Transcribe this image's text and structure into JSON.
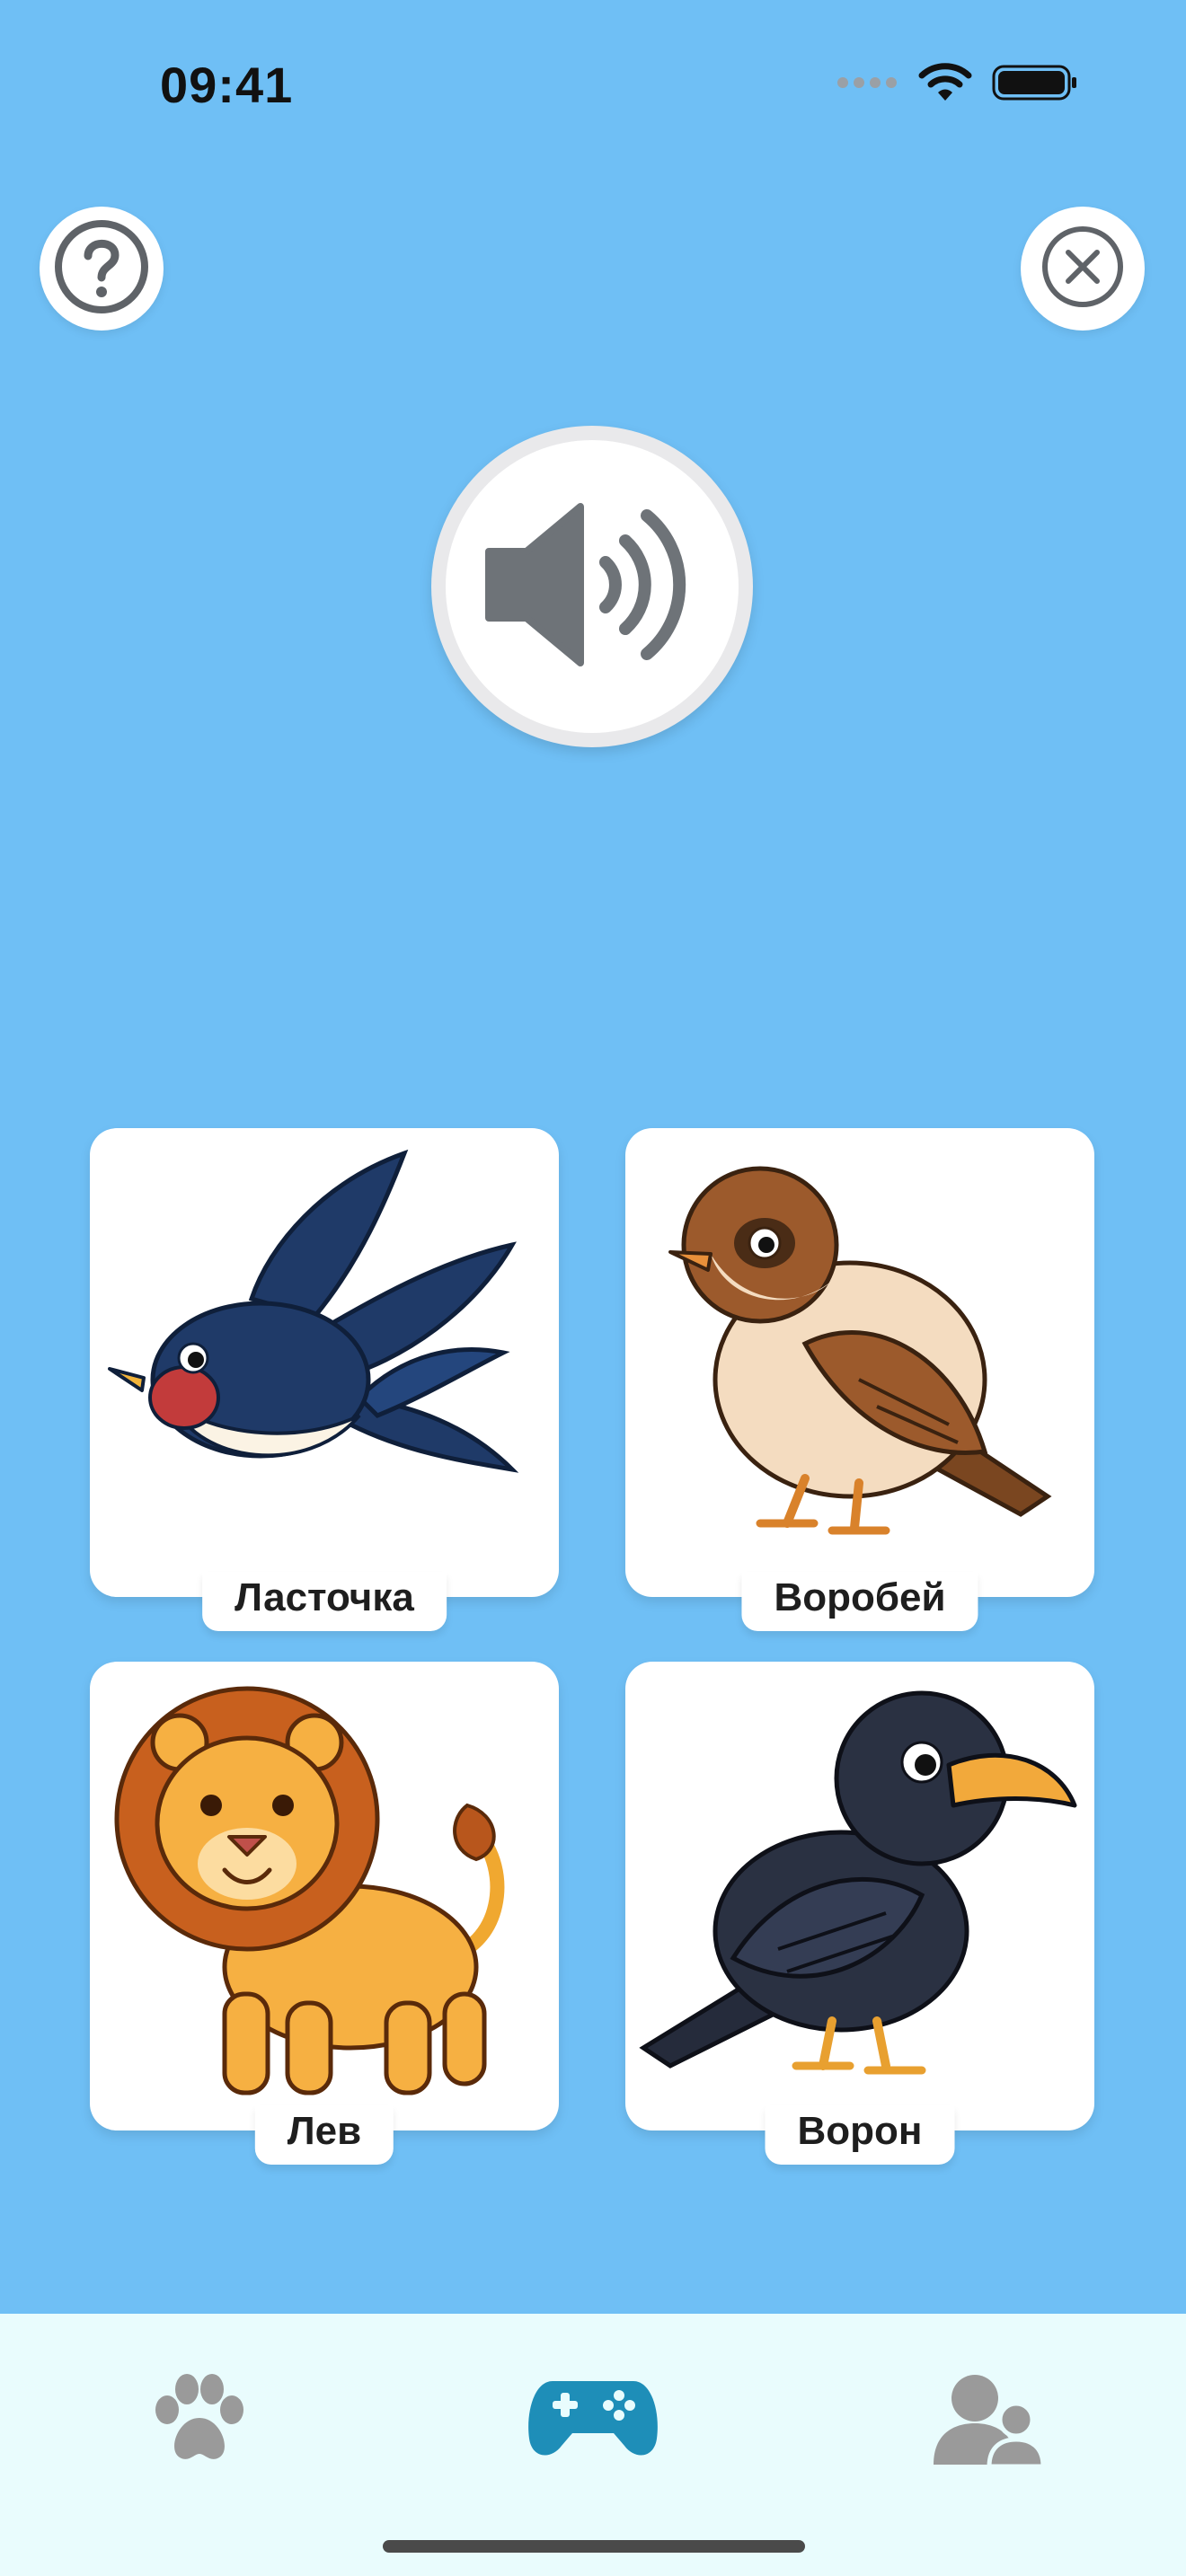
{
  "status_bar": {
    "time": "09:41",
    "icons": [
      "signal-dots-icon",
      "wifi-icon",
      "battery-icon"
    ]
  },
  "top_controls": {
    "help_icon": "question-circle-icon",
    "close_icon": "close-circle-icon"
  },
  "sound_button": {
    "icon": "speaker-icon"
  },
  "cards": [
    {
      "label": "Ласточка",
      "illustration": "swallow"
    },
    {
      "label": "Воробей",
      "illustration": "sparrow"
    },
    {
      "label": "Лев",
      "illustration": "lion"
    },
    {
      "label": "Ворон",
      "illustration": "raven"
    }
  ],
  "tab_bar": {
    "tabs": [
      {
        "icon": "paw-icon",
        "active": false
      },
      {
        "icon": "gamepad-icon",
        "active": true
      },
      {
        "icon": "profile-icon",
        "active": false
      }
    ],
    "active_color": "#1e8eb8",
    "inactive_color": "#9a9a9a"
  },
  "colors": {
    "background": "#6fbff5",
    "tab_bar_background": "#e9fcfd"
  }
}
